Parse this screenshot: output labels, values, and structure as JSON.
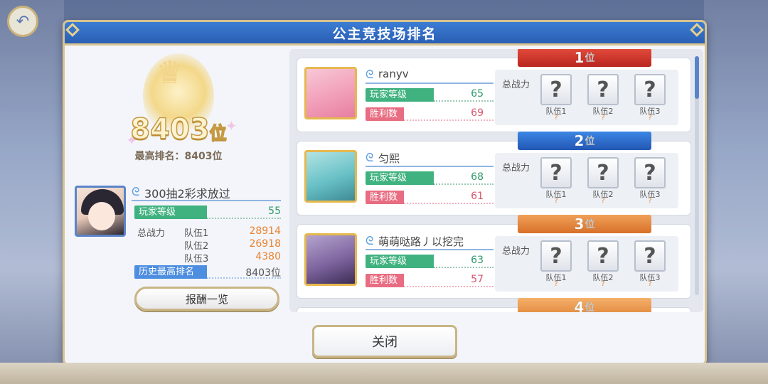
{
  "modal": {
    "title": "公主竞技场排名",
    "close_label": "关闭"
  },
  "self": {
    "rank_value": "8403",
    "rank_unit": "位",
    "best_rank": "最高排名：8403位",
    "name": "300抽2彩求放过",
    "level_label": "玩家等级",
    "level": "55",
    "power_label": "总战力",
    "teams": [
      {
        "label": "队伍1",
        "power": "28914"
      },
      {
        "label": "队伍2",
        "power": "26918"
      },
      {
        "label": "队伍3",
        "power": "4380"
      }
    ],
    "history_label": "历史最高排名",
    "history_value": "8403位",
    "reward_button": "报酬一览"
  },
  "ranking": [
    {
      "rank": "1",
      "unit": "位",
      "name": "ranyv",
      "level_label": "玩家等级",
      "level": "65",
      "wins_label": "胜利数",
      "wins": "69",
      "power_label": "总战力",
      "teams": [
        "队伍1",
        "队伍2",
        "队伍3"
      ],
      "hidden": "?",
      "color": "#c9302a"
    },
    {
      "rank": "2",
      "unit": "位",
      "name": "匀熙",
      "level_label": "玩家等级",
      "level": "68",
      "wins_label": "胜利数",
      "wins": "61",
      "power_label": "总战力",
      "teams": [
        "队伍1",
        "队伍2",
        "队伍3"
      ],
      "hidden": "?",
      "color": "#2c67c6"
    },
    {
      "rank": "3",
      "unit": "位",
      "name": "萌萌哒路丿以挖完",
      "level_label": "玩家等级",
      "level": "63",
      "wins_label": "胜利数",
      "wins": "57",
      "power_label": "总战力",
      "teams": [
        "队伍1",
        "队伍2",
        "队伍3"
      ],
      "hidden": "?",
      "color": "#e07e35"
    },
    {
      "rank": "4",
      "unit": "位"
    }
  ],
  "icons": {
    "back": "back-arrow-icon",
    "name_badge": "swirl-icon",
    "hidden_team": "question-mark-icon"
  }
}
